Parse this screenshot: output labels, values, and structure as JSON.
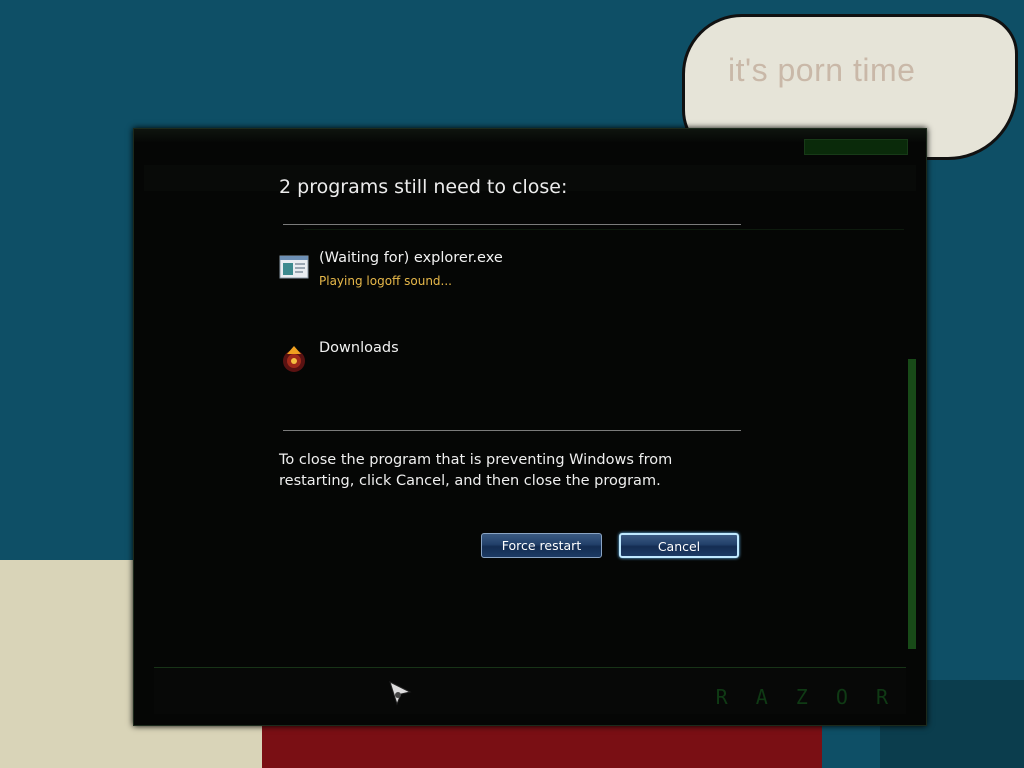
{
  "desktop": {
    "bubble_text": "it's porn time"
  },
  "explorer": {
    "brand": "R A Z O R"
  },
  "dialog": {
    "heading": "2 programs still need to close:",
    "programs": [
      {
        "name": "(Waiting for) explorer.exe",
        "status": "Playing logoff sound...",
        "icon": "explorer-window-icon"
      },
      {
        "name": "Downloads",
        "status": "",
        "icon": "downloads-app-icon"
      }
    ],
    "message": "To close the program that is preventing Windows from restarting, click Cancel, and then close the program.",
    "buttons": {
      "force_restart": "Force restart",
      "cancel": "Cancel"
    }
  },
  "colors": {
    "status_text": "#e7b84a",
    "button_blue": "#22406a",
    "desktop_teal": "#0e4f66"
  }
}
